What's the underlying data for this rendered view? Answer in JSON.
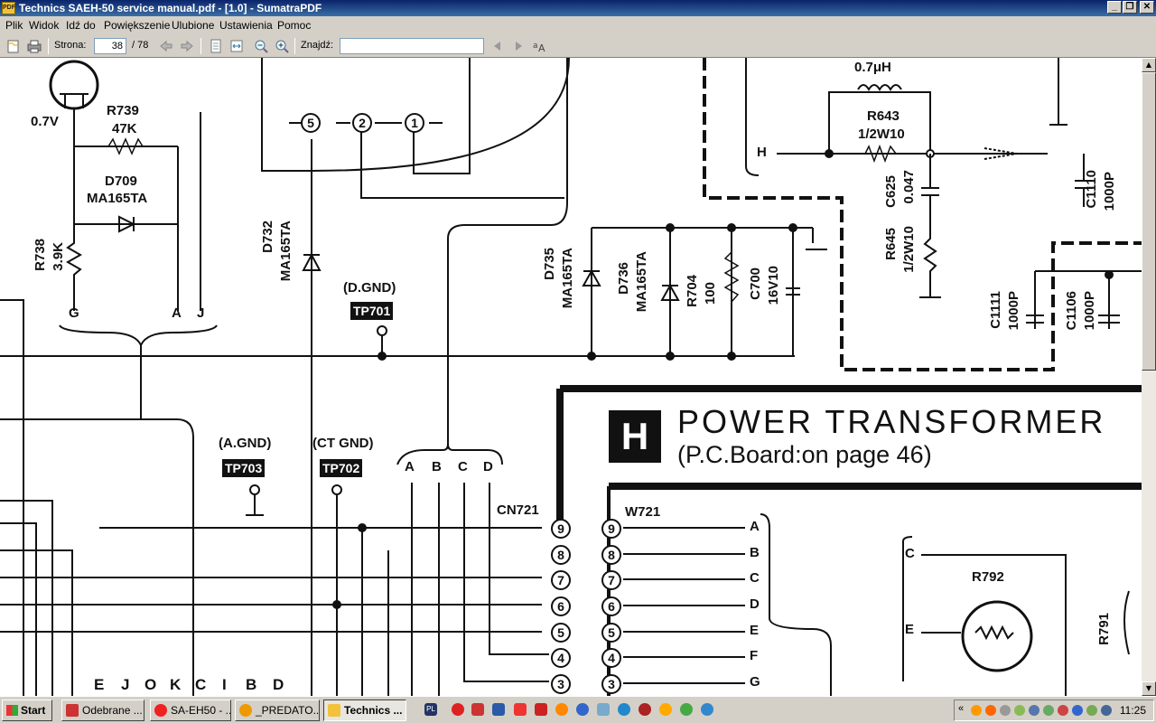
{
  "window": {
    "title": "Technics SAEH-50 service manual.pdf - [1.0] - SumatraPDF",
    "app_icon_text": "PDF",
    "minimize": "_",
    "restore": "❐",
    "close": "✕"
  },
  "menu": [
    "Plik",
    "Widok",
    "Idź do",
    "Powiększenie",
    "Ulubione",
    "Ustawienia",
    "Pomoc"
  ],
  "toolbar": {
    "page_label": "Strona:",
    "page_value": "38",
    "page_total": "/ 78",
    "find_label": "Znajdź:",
    "find_value": ""
  },
  "schematic": {
    "labels": {
      "v07": "0.7V",
      "r739": "R739",
      "r739_val": "47K",
      "d709": "D709",
      "d709_part": "MA165TA",
      "r738": "R738",
      "r738_val": "3.9K",
      "g": "G",
      "a": "A",
      "j": "J",
      "d732": "D732",
      "d732_part": "MA165TA",
      "dgnd": "(D.GND)",
      "agnd": "(A.GND)",
      "ctgnd": "(CT GND)",
      "d735": "D735",
      "d735_part": "MA165TA",
      "d736": "D736",
      "d736_part": "MA165TA",
      "r704": "R704",
      "r704_val": "100",
      "c700": "C700",
      "c700_val": "16V10",
      "l_val": "0.7μH",
      "r643": "R643",
      "r643_val": "1/2W10",
      "c625": "C625",
      "c625_val": "0.047",
      "r645": "R645",
      "r645_val": "1/2W10",
      "h": "H",
      "c1110": "C1110",
      "c1110_val": "1000P",
      "c1111": "C1111",
      "c1111_val": "1000P",
      "c1106": "C1106",
      "c1106_val": "1000P",
      "cn721": "CN721",
      "w721": "W721",
      "r792": "R792",
      "r791": "R791",
      "c_side": "C",
      "e_side": "E",
      "bus_abcd": [
        "A",
        "B",
        "C",
        "D"
      ],
      "bus_bottom": [
        "E",
        "J",
        "O",
        "K",
        "C",
        "I",
        "B",
        "D"
      ],
      "conn_letters": [
        "A",
        "B",
        "C",
        "D",
        "E",
        "F",
        "G"
      ],
      "conn_numbers": [
        "9",
        "8",
        "7",
        "6",
        "5",
        "4",
        "3"
      ],
      "top_nodes": [
        "5",
        "2",
        "1"
      ]
    },
    "test_points": {
      "tp701": "TP701",
      "tp703": "TP703",
      "tp702": "TP702"
    },
    "section": {
      "letter": "H",
      "title": "POWER  TRANSFORMER",
      "subtitle": "(P.C.Board:on page 46)"
    }
  },
  "taskbar": {
    "start": "Start",
    "tasks": [
      "Odebrane ...",
      "SA-EH50 - ...",
      "_PREDATO...",
      "Technics ..."
    ],
    "ql_pl": "PL",
    "clock": "11:25"
  }
}
